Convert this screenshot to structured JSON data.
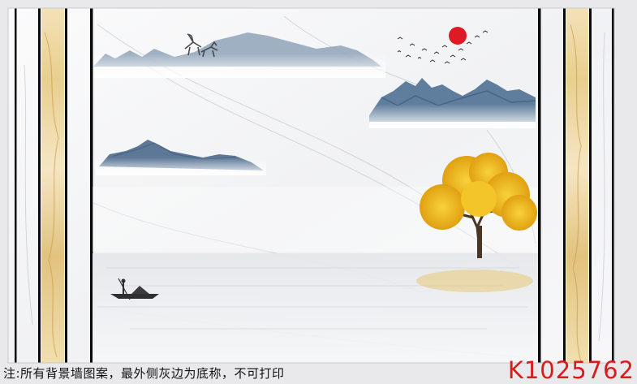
{
  "caption": "注:所有背景墙图案，最外侧灰边为底称，不可打印",
  "product_code": "K1025762",
  "colors": {
    "border_gray": "#e9e9ec",
    "frame_line": "#0b0b0b",
    "gold_tree": "#f0b51a",
    "mountain_blue": "#5f7d9c",
    "sun_red": "#e01a24",
    "code_red": "#d81b1b"
  },
  "icons": [
    "deer-icon",
    "boat-icon",
    "birds-icon",
    "sun-icon",
    "tree-icon"
  ]
}
